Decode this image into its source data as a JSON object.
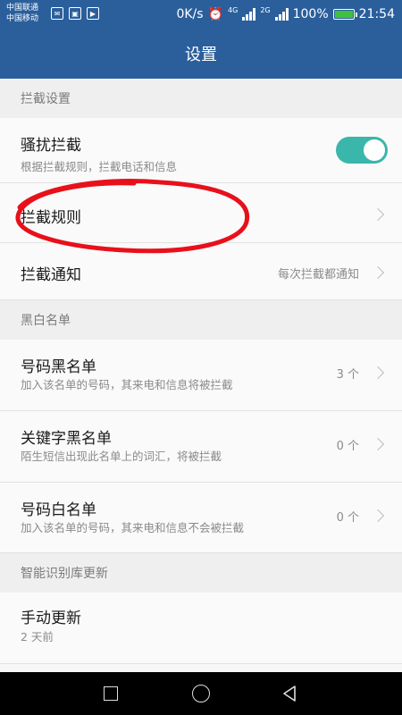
{
  "status_bar": {
    "carrier_1": "中国联通",
    "carrier_2": "中国移动",
    "net_speed": "0K/s",
    "net_4g": "4G",
    "net_2g": "2G",
    "battery": "100%",
    "time": "21:54",
    "icons": [
      "app-notification-icon",
      "image-notification-icon",
      "play-notification-icon",
      "alarm-icon",
      "signal-icon",
      "battery-icon"
    ]
  },
  "header": {
    "title": "设置"
  },
  "sections": {
    "intercept": {
      "header": "拦截设置",
      "harass": {
        "title": "骚扰拦截",
        "subtitle": "根据拦截规则，拦截电话和信息",
        "enabled": true
      },
      "rules": {
        "title": "拦截规则"
      },
      "notify": {
        "title": "拦截通知",
        "value": "每次拦截都通知"
      }
    },
    "lists": {
      "header": "黑白名单",
      "number_blacklist": {
        "title": "号码黑名单",
        "subtitle": "加入该名单的号码，其来电和信息将被拦截",
        "value": "3 个"
      },
      "keyword_blacklist": {
        "title": "关键字黑名单",
        "subtitle": "陌生短信出现此名单上的词汇，将被拦截",
        "value": "0 个"
      },
      "number_whitelist": {
        "title": "号码白名单",
        "subtitle": "加入该名单的号码，其来电和信息不会被拦截",
        "value": "0 个"
      }
    },
    "update": {
      "header": "智能识别库更新",
      "manual": {
        "title": "手动更新",
        "subtitle": "2 天前"
      }
    }
  },
  "colors": {
    "header_bg": "#2a5f9c",
    "toggle_on": "#3ab6ab",
    "annotation": "#e8101a"
  }
}
